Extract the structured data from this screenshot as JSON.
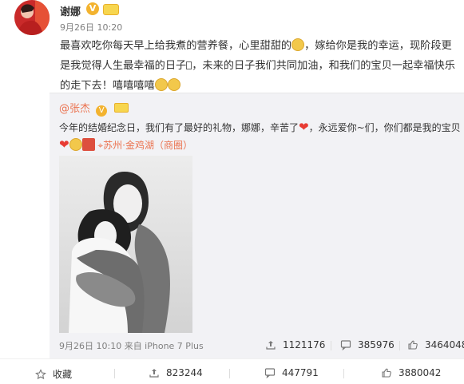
{
  "post": {
    "author": "谢娜",
    "verified_badge": "V",
    "time": "9月26日 10:20",
    "text_1": "最喜欢吃你每天早上给我煮的营养餐，心里甜甜的",
    "text_2": "，嫁给你是我的幸运，现阶段更是我觉得人生最幸福的日子",
    "text_3": "，未来的日子我们共同加油，和我们的宝贝一起幸福快乐的走下去！嘻嘻嘻嘻"
  },
  "repost": {
    "author": "@张杰",
    "verified_badge": "V",
    "text_1": "今年的结婚纪念日，我们有了最好的礼物，娜娜，辛苦了",
    "text_2": "，永远爱你~们，你们都是我的宝贝",
    "heart": "❤",
    "pin": "⌖",
    "location": "苏州·金鸡湖（商圈）",
    "meta": "9月26日 10:10 来自 iPhone 7 Plus",
    "stats": {
      "repost_count": "1121176",
      "comment_count": "385976",
      "like_count": "3464048"
    }
  },
  "actions": {
    "favorite_label": "收藏",
    "repost_count": "823244",
    "comment_count": "447791",
    "like_count": "3880042"
  },
  "colors": {
    "accent": "#eb7350",
    "panel_bg": "#f2f2f5",
    "muted": "#808080"
  },
  "icons": {
    "avatar": "avatar",
    "verified": "verified-v-icon",
    "vip": "vip-crown-icon",
    "repost": "repost-icon",
    "comment": "comment-icon",
    "like": "thumb-up-icon",
    "favorite": "star-icon",
    "location": "location-pin-icon"
  }
}
